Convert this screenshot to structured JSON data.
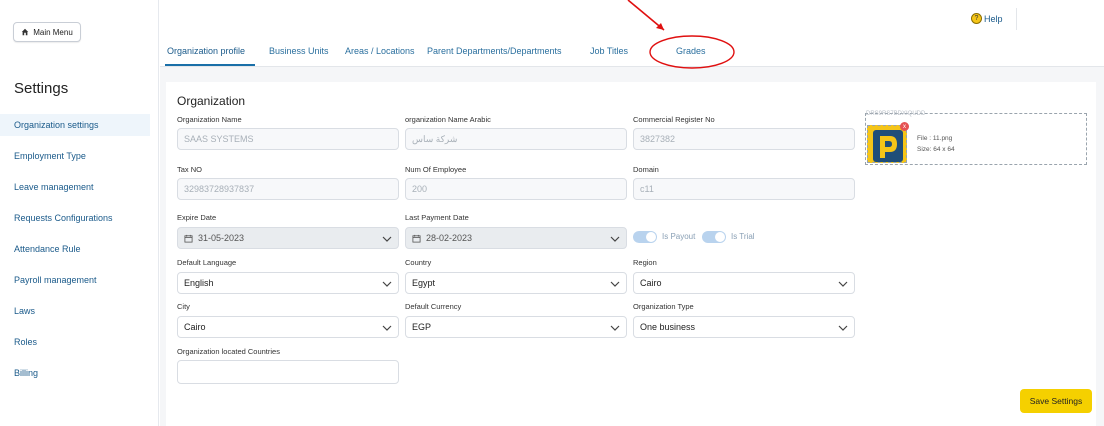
{
  "sidebar": {
    "main_menu_label": "Main Menu",
    "title": "Settings",
    "items": [
      {
        "label": "Organization settings"
      },
      {
        "label": "Employment Type"
      },
      {
        "label": "Leave management"
      },
      {
        "label": "Requests Configurations"
      },
      {
        "label": "Attendance Rule"
      },
      {
        "label": "Payroll management"
      },
      {
        "label": "Laws"
      },
      {
        "label": "Roles"
      },
      {
        "label": "Billing"
      }
    ]
  },
  "header": {
    "help_label": "Help",
    "help_icon_glyph": "?"
  },
  "tabs": [
    {
      "label": "Organization profile"
    },
    {
      "label": "Business Units"
    },
    {
      "label": "Areas / Locations"
    },
    {
      "label": "Parent Departments/Departments"
    },
    {
      "label": "Job Titles"
    },
    {
      "label": "Grades"
    }
  ],
  "form": {
    "section_title": "Organization",
    "org_name": {
      "label": "Organization Name",
      "value": "SAAS SYSTEMS"
    },
    "org_name_ar": {
      "label": "organization Name Arabic",
      "value": "شركة ساس"
    },
    "commercial_reg": {
      "label": "Commercial Register No",
      "value": "3827382"
    },
    "tax_no": {
      "label": "Tax NO",
      "value": "32983728937837"
    },
    "num_employee": {
      "label": "Num Of Employee",
      "value": "200"
    },
    "domain": {
      "label": "Domain",
      "value": "c11"
    },
    "expire_date": {
      "label": "Expire Date",
      "value": "31-05-2023"
    },
    "last_payment": {
      "label": "Last Payment Date",
      "value": "28-02-2023"
    },
    "is_payout": {
      "label": "Is Payout",
      "on": true
    },
    "is_trial": {
      "label": "Is Trial",
      "on": true
    },
    "default_language": {
      "label": "Default Language",
      "value": "English"
    },
    "country": {
      "label": "Country",
      "value": "Egypt"
    },
    "region": {
      "label": "Region",
      "value": "Cairo"
    },
    "city": {
      "label": "City",
      "value": "Cairo"
    },
    "default_currency": {
      "label": "Default Currency",
      "value": "EGP"
    },
    "org_type": {
      "label": "Organization Type",
      "value": "One business"
    },
    "located_countries": {
      "label": "Organization located Countries",
      "value": ""
    }
  },
  "upload": {
    "hint": "DRS9RS7BDXIQUDD",
    "file_name": "File : 11.png",
    "file_size": "Size: 64 x 64",
    "remove_glyph": "x"
  },
  "actions": {
    "save_label": "Save Settings"
  },
  "colors": {
    "accent": "#1a6fa8",
    "save": "#f5d000",
    "annotation": "#e01010"
  }
}
